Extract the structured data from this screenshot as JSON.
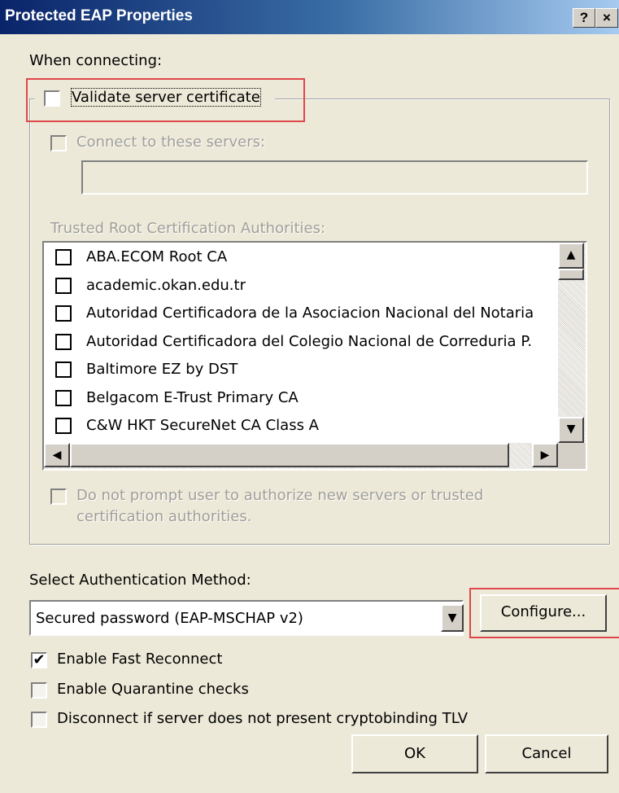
{
  "window": {
    "title": "Protected EAP Properties",
    "help_glyph": "?",
    "close_glyph": "×"
  },
  "when_connecting_label": "When connecting:",
  "validate_cert": {
    "label": "Validate server certificate",
    "checked": false
  },
  "connect_servers": {
    "label": "Connect to these servers:",
    "checked": false,
    "value": ""
  },
  "trusted_root_label": "Trusted Root Certification Authorities:",
  "ca_list": [
    {
      "name": "ABA.ECOM Root CA",
      "checked": false
    },
    {
      "name": "academic.okan.edu.tr",
      "checked": false
    },
    {
      "name": "Autoridad Certificadora de la Asociacion Nacional del Notaria",
      "checked": false
    },
    {
      "name": "Autoridad Certificadora del Colegio Nacional de Correduria P.",
      "checked": false
    },
    {
      "name": "Baltimore EZ by DST",
      "checked": false
    },
    {
      "name": "Belgacom E-Trust Primary CA",
      "checked": false
    },
    {
      "name": "C&W HKT SecureNet CA Class A",
      "checked": false
    }
  ],
  "do_not_prompt": {
    "line1": "Do not prompt user to authorize new servers or trusted",
    "line2": "certification authorities.",
    "checked": false
  },
  "select_method_label": "Select Authentication Method:",
  "auth_method": {
    "selected": "Secured password (EAP-MSCHAP v2)"
  },
  "configure_label": "Configure...",
  "enable_fast_reconnect": {
    "label": "Enable Fast Reconnect",
    "checked": true
  },
  "enable_quarantine": {
    "label": "Enable Quarantine checks",
    "checked": false
  },
  "disconnect_no_tlv": {
    "label": "Disconnect if server does not present cryptobinding TLV",
    "checked": false
  },
  "ok_label": "OK",
  "cancel_label": "Cancel",
  "icons": {
    "checkmark": "✔",
    "scroll_up": "▲",
    "scroll_down": "▼",
    "scroll_left": "◀",
    "scroll_right": "▶",
    "dropdown": "▼"
  },
  "colors": {
    "highlight_box": "#e0474c",
    "titlebar": "#0a246a",
    "dialog_bg": "#ece9d8"
  }
}
